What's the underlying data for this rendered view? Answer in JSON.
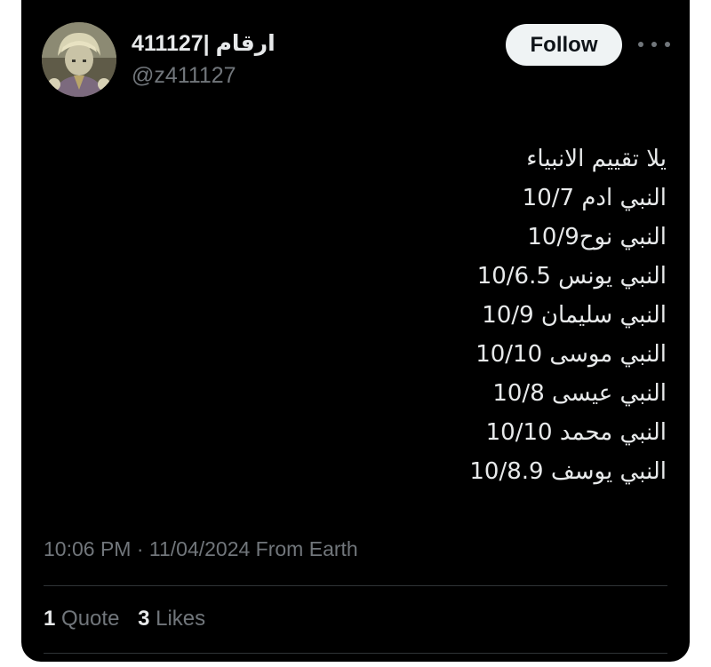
{
  "author": {
    "display_name": "411127| ارقام",
    "handle": "@z411127"
  },
  "actions": {
    "follow_label": "Follow",
    "more_icon": "more-horizontal-icon"
  },
  "tweet": {
    "lines": [
      "يلا تقييم الانبياء",
      "النبي ادم 10/7",
      "النبي نوح10/9",
      "النبي يونس 10/6.5",
      "النبي سليمان 10/9",
      "النبي موسى 10/10",
      "النبي عيسى 10/8",
      "النبي محمد 10/10",
      "النبي يوسف 10/8.9"
    ],
    "timestamp_line": "10:06 PM · 11/04/2024 From Earth"
  },
  "stats": {
    "quotes_count": "1",
    "quotes_label": "Quote",
    "likes_count": "3",
    "likes_label": "Likes"
  },
  "colors": {
    "background": "#000000",
    "primary_text": "#e7e9ea",
    "secondary_text": "#71767b",
    "divider": "#2f3336",
    "follow_button_bg": "#eff3f4"
  }
}
